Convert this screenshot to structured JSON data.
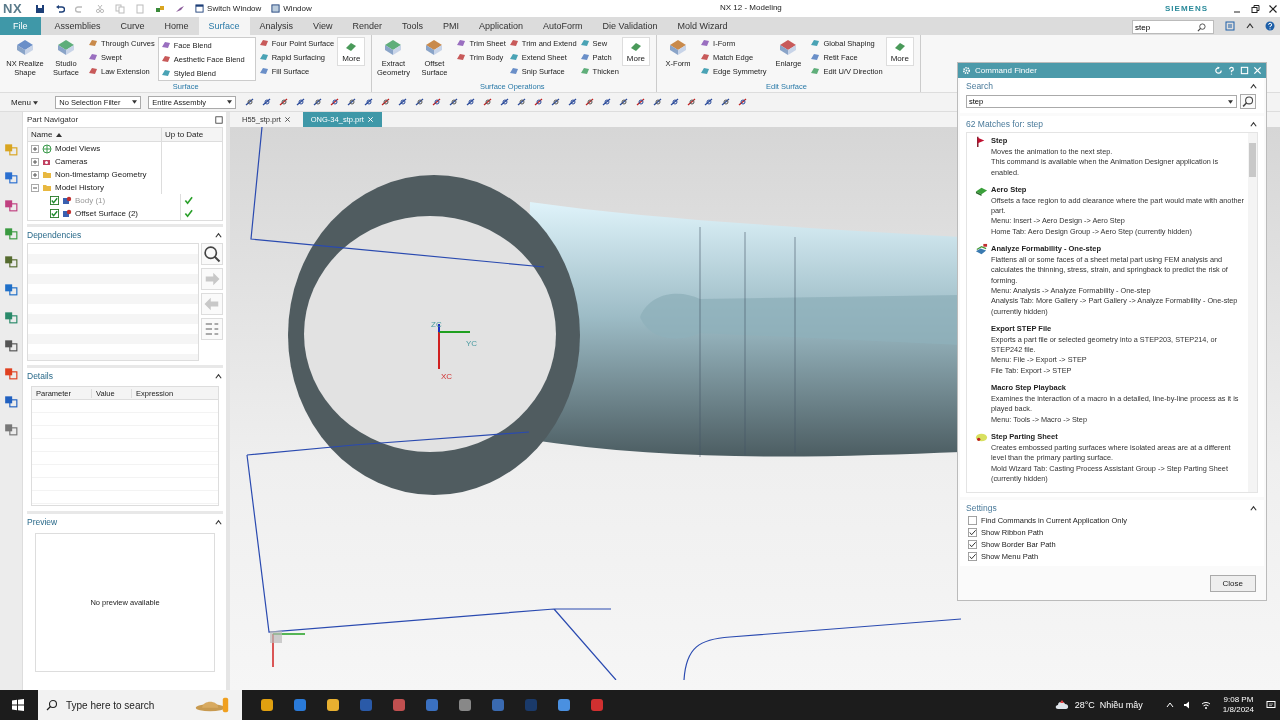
{
  "title_bar": {
    "logo": "NX",
    "quick_access": [
      {
        "label": "Switch Window",
        "kind": "switch"
      },
      {
        "label": "Window",
        "kind": "window"
      }
    ],
    "title": "NX 12 - Modeling",
    "brand": "SIEMENS"
  },
  "menu_tabs": [
    {
      "label": "File",
      "kind": "file",
      "selected": false
    },
    {
      "label": "Assemblies",
      "kind": "tab",
      "selected": false
    },
    {
      "label": "Curve",
      "kind": "tab",
      "selected": false
    },
    {
      "label": "Home",
      "kind": "tab",
      "selected": false
    },
    {
      "label": "Surface",
      "kind": "tab",
      "selected": true
    },
    {
      "label": "Analysis",
      "kind": "tab",
      "selected": false
    },
    {
      "label": "View",
      "kind": "tab",
      "selected": false
    },
    {
      "label": "Render",
      "kind": "tab",
      "selected": false
    },
    {
      "label": "Tools",
      "kind": "tab",
      "selected": false
    },
    {
      "label": "PMI",
      "kind": "tab",
      "selected": false
    },
    {
      "label": "Application",
      "kind": "tab",
      "selected": false
    },
    {
      "label": "AutoForm",
      "kind": "tab",
      "selected": false
    },
    {
      "label": "Die Validation",
      "kind": "tab",
      "selected": false
    },
    {
      "label": "Mold Wizard",
      "kind": "tab",
      "selected": false
    }
  ],
  "ribbon_search": {
    "value": "step"
  },
  "ribbon_groups": [
    {
      "label": "Surface",
      "columns": [
        {
          "kind": "large",
          "label": "NX Realize Shape"
        },
        {
          "kind": "large",
          "label": "Studio Surface"
        },
        {
          "kind": "small",
          "items": [
            "Through Curves",
            "Swept",
            "Law Extension"
          ]
        },
        {
          "kind": "gallery",
          "items": [
            "Face Blend",
            "Aesthetic Face Blend",
            "Styled Blend"
          ]
        },
        {
          "kind": "small",
          "items": [
            "Four Point Surface",
            "Rapid Surfacing",
            "Fill Surface"
          ]
        },
        {
          "kind": "more",
          "label": "More"
        }
      ]
    },
    {
      "label": "Surface Operations",
      "columns": [
        {
          "kind": "large",
          "label": "Extract Geometry"
        },
        {
          "kind": "large",
          "label": "Offset Surface"
        },
        {
          "kind": "small",
          "items": [
            "Trim Sheet",
            "Trim Body"
          ]
        },
        {
          "kind": "small",
          "items": [
            "Trim and Extend",
            "Extend Sheet",
            "Snip Surface"
          ]
        },
        {
          "kind": "small",
          "items": [
            "Sew",
            "Patch",
            "Thicken"
          ]
        },
        {
          "kind": "more",
          "label": "More"
        }
      ]
    },
    {
      "label": "Edit Surface",
      "columns": [
        {
          "kind": "large",
          "label": "X-Form"
        },
        {
          "kind": "small",
          "items": [
            "I-Form",
            "Match Edge",
            "Edge Symmetry"
          ]
        },
        {
          "kind": "large",
          "label": "Enlarge"
        },
        {
          "kind": "small",
          "items": [
            "Global Shaping",
            "Retit Face",
            "Edit U/V Direction"
          ]
        },
        {
          "kind": "more",
          "label": "More"
        }
      ]
    }
  ],
  "toolbar": {
    "menu": "Menu",
    "selection_filter": "No Selection Filter",
    "scope": "Entire Assembly"
  },
  "doc_tabs": [
    {
      "label": "H55_stp.prt",
      "selected": false
    },
    {
      "label": "ONG-34_stp.prt",
      "selected": true
    }
  ],
  "part_navigator": {
    "title": "Part Navigator",
    "columns": [
      "Name",
      "Up to Date"
    ],
    "tree": [
      {
        "label": "Model Views",
        "expanded": false,
        "kind": "views"
      },
      {
        "label": "Cameras",
        "expanded": false,
        "kind": "cameras"
      },
      {
        "label": "Non-timestamp Geometry",
        "expanded": false,
        "kind": "folder"
      },
      {
        "label": "Model History",
        "expanded": true,
        "kind": "folder",
        "children": [
          {
            "label": "Body (1)",
            "checked": true,
            "dimmed": true,
            "up_to_date": true
          },
          {
            "label": "Offset Surface (2)",
            "checked": true,
            "dimmed": false,
            "up_to_date": true
          }
        ]
      }
    ]
  },
  "dependencies": {
    "title": "Dependencies"
  },
  "details": {
    "title": "Details",
    "columns": [
      "Parameter",
      "Value",
      "Expression"
    ]
  },
  "preview": {
    "title": "Preview",
    "message": "No preview available"
  },
  "viewport": {
    "axis_labels": [
      "ZC",
      "YC",
      "XC"
    ]
  },
  "command_finder": {
    "title": "Command Finder",
    "search_label": "Search",
    "query": "step",
    "results_heading": "62 Matches for: step",
    "results": [
      {
        "kind": "flag",
        "title": "Step",
        "lines": [
          "Moves the animation to the next step.",
          "This command is available when the Animation Designer application is enabled."
        ]
      },
      {
        "kind": "aero",
        "title": "Aero Step",
        "lines": [
          "Offsets a face region to add clearance where the part would mate with another part.",
          "Menu: Insert -> Aero Design -> Aero Step",
          "Home Tab: Aero Design Group -> Aero Step (currently hidden)"
        ]
      },
      {
        "kind": "formability",
        "title": "Analyze Formability - One-step",
        "lines": [
          "Flattens all or some faces of a sheet metal part using FEM analysis and calculates the thinning, stress, strain, and springback to predict the risk of forming.",
          "Menu: Analysis -> Analyze Formability - One-step",
          "Analysis Tab: More Gallery -> Part Gallery -> Analyze Formability - One-step (currently hidden)"
        ]
      },
      {
        "kind": "none",
        "title": "Export STEP File",
        "lines": [
          "Exports a part file or selected geometry into a STEP203, STEP214, or STEP242 file.",
          "Menu: File -> Export -> STEP",
          "File Tab: Export -> STEP"
        ]
      },
      {
        "kind": "none",
        "title": "Macro Step Playback",
        "lines": [
          "Examines the interaction of a macro in a detailed, line-by-line process as it is played back.",
          "Menu: Tools -> Macro -> Step"
        ]
      },
      {
        "kind": "parting",
        "title": "Step Parting Sheet",
        "lines": [
          "Creates embossed parting surfaces where isolated areas are at a different level than the primary parting surface.",
          "Mold Wizard Tab: Casting Process Assistant Group -> Step Parting Sheet (currently hidden)"
        ]
      }
    ],
    "settings_label": "Settings",
    "options": [
      {
        "label": "Find Commands in Current Application Only",
        "checked": false
      },
      {
        "label": "Show Ribbon Path",
        "checked": true
      },
      {
        "label": "Show Border Bar Path",
        "checked": true
      },
      {
        "label": "Show Menu Path",
        "checked": true
      }
    ],
    "close": "Close"
  },
  "taskbar": {
    "search_placeholder": "Type here to search",
    "weather": "28°C  Nhiều mây",
    "time": "9:08 PM",
    "date": "1/8/2024"
  }
}
